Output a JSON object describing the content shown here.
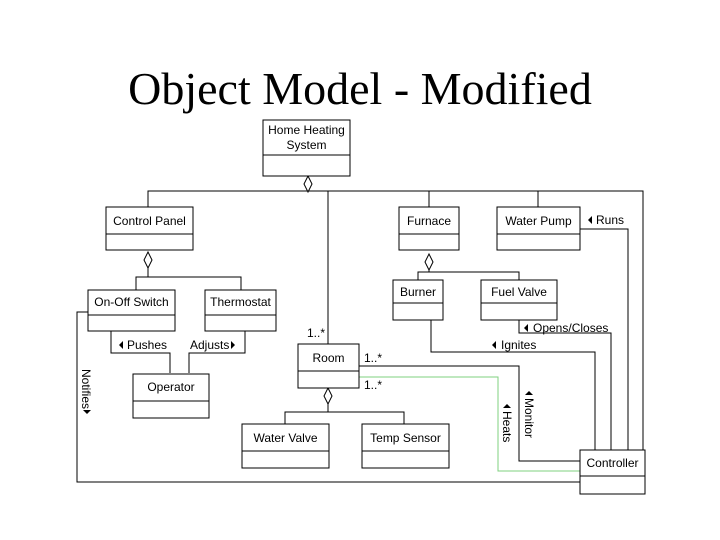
{
  "title": "Object Model - Modified",
  "classes": {
    "home_heating_system": {
      "line1": "Home Heating",
      "line2": "System"
    },
    "control_panel": "Control Panel",
    "furnace": "Furnace",
    "water_pump": "Water Pump",
    "on_off_switch": "On-Off Switch",
    "thermostat": "Thermostat",
    "burner": "Burner",
    "fuel_valve": "Fuel Valve",
    "room": "Room",
    "operator": "Operator",
    "water_valve": "Water Valve",
    "temp_sensor": "Temp Sensor",
    "controller": "Controller"
  },
  "associations": {
    "runs": "Runs",
    "opens_closes": "Opens/Closes",
    "ignites": "Ignites",
    "pushes": "Pushes",
    "adjusts": "Adjusts",
    "notifies": "Notifies",
    "monitor": "Monitor",
    "heats": "Heats"
  },
  "multiplicities": {
    "room_top": "1..*",
    "room_monitor": "1..*",
    "room_heats": "1..*"
  },
  "colors": {
    "heats_line": "#7fd07f"
  }
}
